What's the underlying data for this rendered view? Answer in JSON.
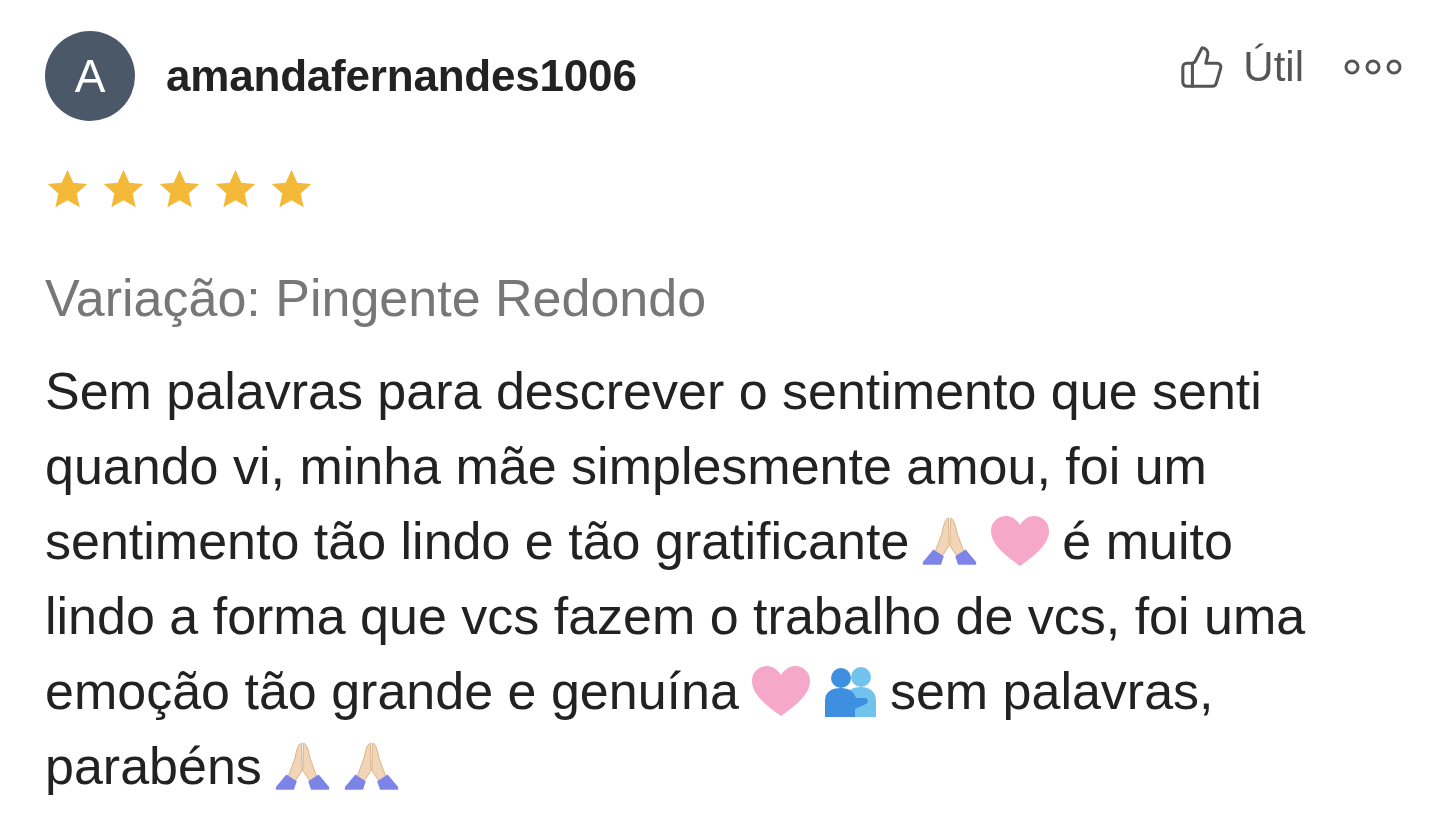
{
  "author": {
    "avatar_letter": "A",
    "username": "amandafernandes1006"
  },
  "actions": {
    "helpful_label": "Útil"
  },
  "rating": {
    "stars": 5
  },
  "variation": "Variação: Pingente Redondo",
  "review_lines": [
    {
      "parts": [
        {
          "kind": "text",
          "text": "Sem palavras para descrever o sentimento que senti"
        }
      ]
    },
    {
      "parts": [
        {
          "kind": "text",
          "text": "quando vi, minha mãe simplesmente amou, foi um"
        }
      ]
    },
    {
      "parts": [
        {
          "kind": "text",
          "text": "sentimento tão lindo e tão gratificante"
        },
        {
          "kind": "pray"
        },
        {
          "kind": "heart"
        },
        {
          "kind": "text",
          "text": "é muito"
        }
      ]
    },
    {
      "parts": [
        {
          "kind": "text",
          "text": "lindo a forma que vcs fazem o trabalho de vcs, foi uma"
        }
      ]
    },
    {
      "parts": [
        {
          "kind": "text",
          "text": "emoção tão grande e genuína"
        },
        {
          "kind": "heart"
        },
        {
          "kind": "hug"
        },
        {
          "kind": "text",
          "text": "sem palavras,"
        }
      ]
    },
    {
      "parts": [
        {
          "kind": "text",
          "text": "parabéns"
        },
        {
          "kind": "pray"
        },
        {
          "kind": "pray"
        }
      ]
    }
  ]
}
